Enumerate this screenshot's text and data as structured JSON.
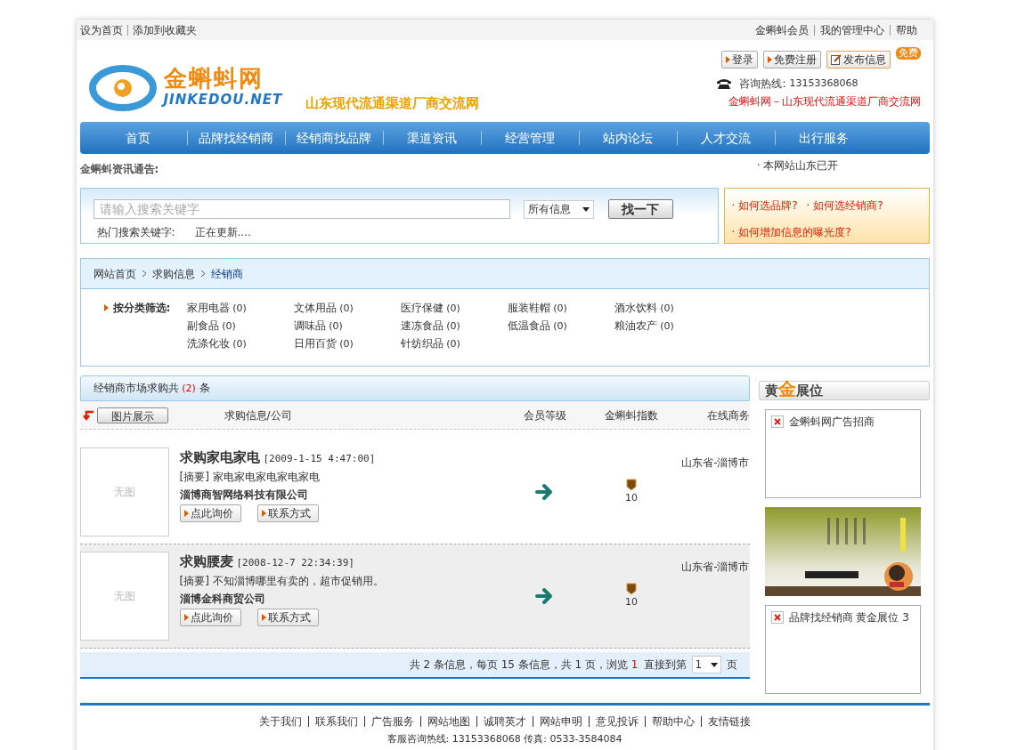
{
  "top_links_left": [
    "设为首页",
    "添加到收藏夹"
  ],
  "top_links_right": [
    "金蝌蚪会员",
    "我的管理中心",
    "帮助"
  ],
  "logo": {
    "name": "金蝌蚪网",
    "domain": "JINKEDOU.NET"
  },
  "slogan": "山东现代流通渠道厂商交流网",
  "account_buttons": [
    {
      "label": "登录",
      "kind": "arrow"
    },
    {
      "label": "免费注册",
      "kind": "arrow"
    },
    {
      "label": "发布信息",
      "kind": "edit"
    }
  ],
  "free_badge": "免费",
  "hotline": {
    "label": "咨询热线:",
    "number": "13153368068"
  },
  "tagline": "金蝌蚪网－山东现代流通渠道厂商交流网",
  "nav": [
    "首页",
    "品牌找经销商",
    "经销商找品牌",
    "渠道资讯",
    "经营管理",
    "站内论坛",
    "人才交流",
    "出行服务"
  ],
  "notice": {
    "label": "金蝌蚪资讯通告:",
    "item": "· 本网站山东已开"
  },
  "search": {
    "placeholder": "请输入搜索关键字",
    "scope": "所有信息",
    "button": "找一下",
    "hot_label": "热门搜索关键字:",
    "hot_value": "正在更新...."
  },
  "tips": [
    "· 如何选品牌?",
    "· 如何选经销商?",
    "· 如何增加信息的曝光度?"
  ],
  "breadcrumb": [
    "网站首页",
    "求购信息",
    "经销商"
  ],
  "filter": {
    "label": "按分类筛选:",
    "categories": [
      {
        "name": "家用电器",
        "count": "(0)"
      },
      {
        "name": "文体用品",
        "count": "(0)"
      },
      {
        "name": "医疗保健",
        "count": "(0)"
      },
      {
        "name": "服装鞋帽",
        "count": "(0)"
      },
      {
        "name": "酒水饮料",
        "count": "(0)"
      },
      {
        "name": "副食品",
        "count": "(0)"
      },
      {
        "name": "调味品",
        "count": "(0)"
      },
      {
        "name": "速冻食品",
        "count": "(0)"
      },
      {
        "name": "低温食品",
        "count": "(0)"
      },
      {
        "name": "粮油农产",
        "count": "(0)"
      },
      {
        "name": "洗涤化妆",
        "count": "(0)"
      },
      {
        "name": "日用百货",
        "count": "(0)"
      },
      {
        "name": "针纺织品",
        "count": "(0)"
      }
    ]
  },
  "list": {
    "title_prefix": "经销商市场求购共",
    "count": "(2)",
    "title_suffix": "条",
    "view_button": "图片展示",
    "columns": [
      "求购信息/公司",
      "会员等级",
      "金蝌蚪指数",
      "在线商务"
    ],
    "rows": [
      {
        "no_image": "无图",
        "title": "求购家电家电",
        "time": "[2009-1-15 4:47:00]",
        "summary": "[摘要] 家电家电家电家电家电",
        "company": "淄博商智网络科技有限公司",
        "buttons": [
          "点此询价",
          "联系方式"
        ],
        "index": "10",
        "location": "山东省-淄博市",
        "highlighted": false
      },
      {
        "no_image": "无图",
        "title": "求购腰麦",
        "time": "[2008-12-7 22:34:39]",
        "summary": "[摘要] 不知淄博哪里有卖的，超市促销用。",
        "company": "淄博金科商贸公司",
        "buttons": [
          "点此询价",
          "联系方式"
        ],
        "index": "10",
        "location": "山东省-淄博市",
        "highlighted": true
      }
    ]
  },
  "pager": {
    "text": "共 2 条信息，每页 15 条信息，共 1 页，浏览",
    "current": "1",
    "jump_label": "直接到第",
    "page_select": "1",
    "unit": "页"
  },
  "sidebar": {
    "title_parts": [
      "黄",
      "金",
      "展位"
    ],
    "ads": [
      {
        "kind": "text",
        "text": "金蝌蚪网广告招商"
      },
      {
        "kind": "picture"
      },
      {
        "kind": "text",
        "text": "品牌找经销商 黄金展位 3"
      }
    ]
  },
  "footer": {
    "links": [
      "关于我们",
      "联系我们",
      "广告服务",
      "网站地图",
      "诚聘英才",
      "网站申明",
      "意见投诉",
      "帮助中心",
      "友情链接"
    ],
    "contact": "客服咨询热线: 13153368068 传真: 0533-3584084"
  }
}
